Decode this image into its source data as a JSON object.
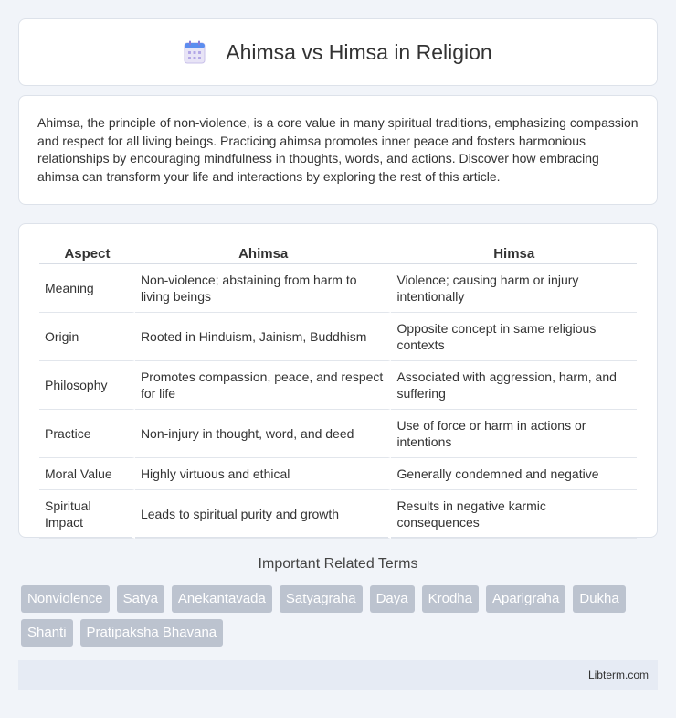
{
  "header": {
    "title": "Ahimsa vs Himsa in Religion",
    "icon": "calendar-icon"
  },
  "intro": {
    "text": "Ahimsa, the principle of non-violence, is a core value in many spiritual traditions, emphasizing compassion and respect for all living beings. Practicing ahimsa promotes inner peace and fosters harmonious relationships by encouraging mindfulness in thoughts, words, and actions. Discover how embracing ahimsa can transform your life and interactions by exploring the rest of this article."
  },
  "table": {
    "headers": [
      "Aspect",
      "Ahimsa",
      "Himsa"
    ],
    "rows": [
      [
        "Meaning",
        "Non-violence; abstaining from harm to living beings",
        "Violence; causing harm or injury intentionally"
      ],
      [
        "Origin",
        "Rooted in Hinduism, Jainism, Buddhism",
        "Opposite concept in same religious contexts"
      ],
      [
        "Philosophy",
        "Promotes compassion, peace, and respect for life",
        "Associated with aggression, harm, and suffering"
      ],
      [
        "Practice",
        "Non-injury in thought, word, and deed",
        "Use of force or harm in actions or intentions"
      ],
      [
        "Moral Value",
        "Highly virtuous and ethical",
        "Generally condemned and negative"
      ],
      [
        "Spiritual Impact",
        "Leads to spiritual purity and growth",
        "Results in negative karmic consequences"
      ]
    ]
  },
  "related": {
    "title": "Important Related Terms",
    "tags": [
      "Nonviolence",
      "Satya",
      "Anekantavada",
      "Satyagraha",
      "Daya",
      "Krodha",
      "Aparigraha",
      "Dukha",
      "Shanti",
      "Pratipaksha Bhavana"
    ]
  },
  "footer": {
    "text": "Libterm.com"
  },
  "colors": {
    "background": "#f1f4f9",
    "tag": "#bcc3cf",
    "footer": "#e6ebf4"
  }
}
